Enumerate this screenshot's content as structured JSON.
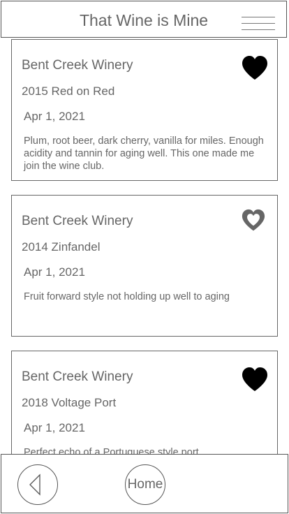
{
  "header": {
    "title": "That Wine is Mine",
    "menu_icon": "hamburger-menu-icon"
  },
  "entries": [
    {
      "winery": "Bent Creek Winery",
      "wine": "2015 Red on Red",
      "date": "Apr 1, 2021",
      "notes": "Plum, root beer, dark cherry, vanilla for miles. Enough acidity and tannin for aging well.  This one made me join the wine club.",
      "favorite": true,
      "heart_icon": "heart-filled-icon"
    },
    {
      "winery": "Bent Creek Winery",
      "wine": "2014 Zinfandel",
      "date": "Apr 1, 2021",
      "notes": "Fruit forward style not holding up well to aging",
      "favorite": false,
      "heart_icon": "heart-outline-icon"
    },
    {
      "winery": "Bent Creek Winery",
      "wine": "2018 Voltage Port",
      "date": "Apr 1, 2021",
      "notes": "Perfect echo of a Portuguese style port",
      "favorite": true,
      "heart_icon": "heart-filled-icon"
    }
  ],
  "footer": {
    "back_icon": "back-arrow-icon",
    "home_label": "Home"
  },
  "colors": {
    "text": "#666666",
    "border": "#555555",
    "heart_filled": "#000000",
    "heart_outline": "#666666"
  }
}
